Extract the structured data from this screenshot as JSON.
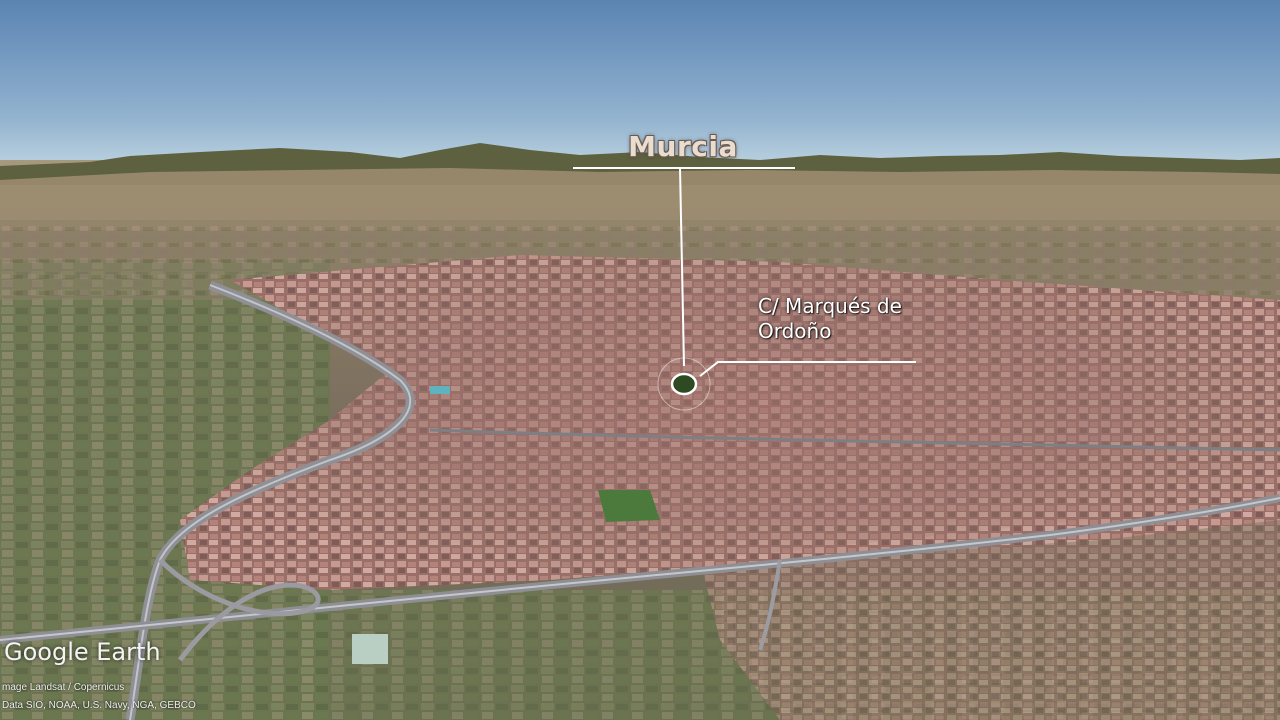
{
  "map": {
    "place_label": "Murcia",
    "street_label_line1": "C/ Marqués de",
    "street_label_line2": "Ordoño",
    "marker_color": "#2e4a23",
    "sky_color_top": "#5f87b5",
    "sky_color_horizon": "#b6cfdf"
  },
  "branding": {
    "logo_text": "Google Earth",
    "credit_line1": "mage Landsat / Copernicus",
    "credit_line2": "Data SIO, NOAA, U.S. Navy, NGA, GEBCO"
  }
}
